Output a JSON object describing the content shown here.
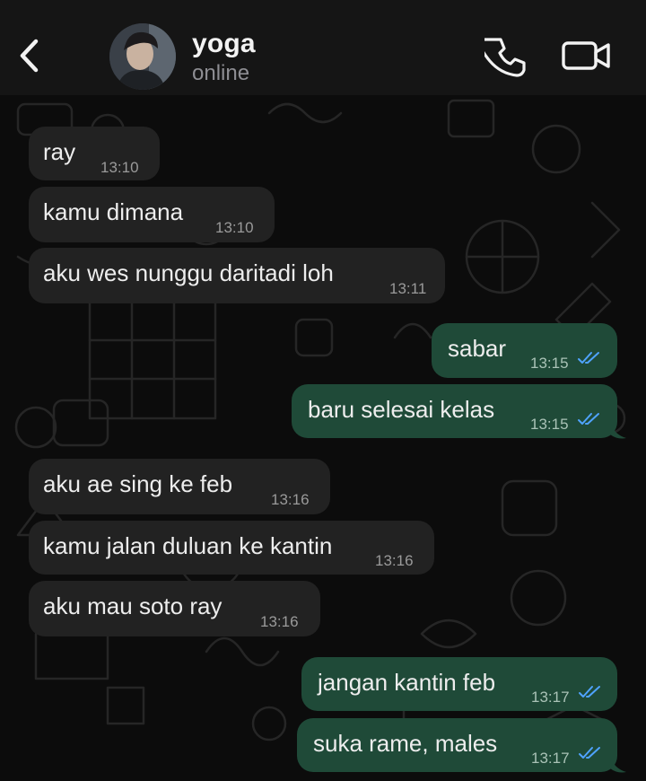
{
  "header": {
    "contact_name": "yoga",
    "status": "online",
    "icons": {
      "back": "chevron-left-icon",
      "call": "phone-icon",
      "video": "video-camera-icon"
    }
  },
  "colors": {
    "header_bg": "#151515",
    "incoming_bubble": "#222222",
    "outgoing_bubble": "#1f4a38",
    "read_ticks": "#4fa3ff"
  },
  "messages": [
    {
      "direction": "in",
      "text": "ray",
      "time": "13:10"
    },
    {
      "direction": "in",
      "text": "kamu dimana",
      "time": "13:10"
    },
    {
      "direction": "in",
      "text": "aku wes nunggu daritadi loh",
      "time": "13:11"
    },
    {
      "direction": "out",
      "text": "sabar",
      "time": "13:15",
      "status": "read"
    },
    {
      "direction": "out",
      "text": "baru selesai kelas",
      "time": "13:15",
      "status": "read"
    },
    {
      "direction": "in",
      "text": "aku ae sing ke feb",
      "time": "13:16"
    },
    {
      "direction": "in",
      "text": "kamu jalan duluan ke kantin",
      "time": "13:16"
    },
    {
      "direction": "in",
      "text": "aku mau soto ray",
      "time": "13:16"
    },
    {
      "direction": "out",
      "text": "jangan kantin feb",
      "time": "13:17",
      "status": "read"
    },
    {
      "direction": "out",
      "text": "suka rame, males",
      "time": "13:17",
      "status": "read"
    }
  ]
}
